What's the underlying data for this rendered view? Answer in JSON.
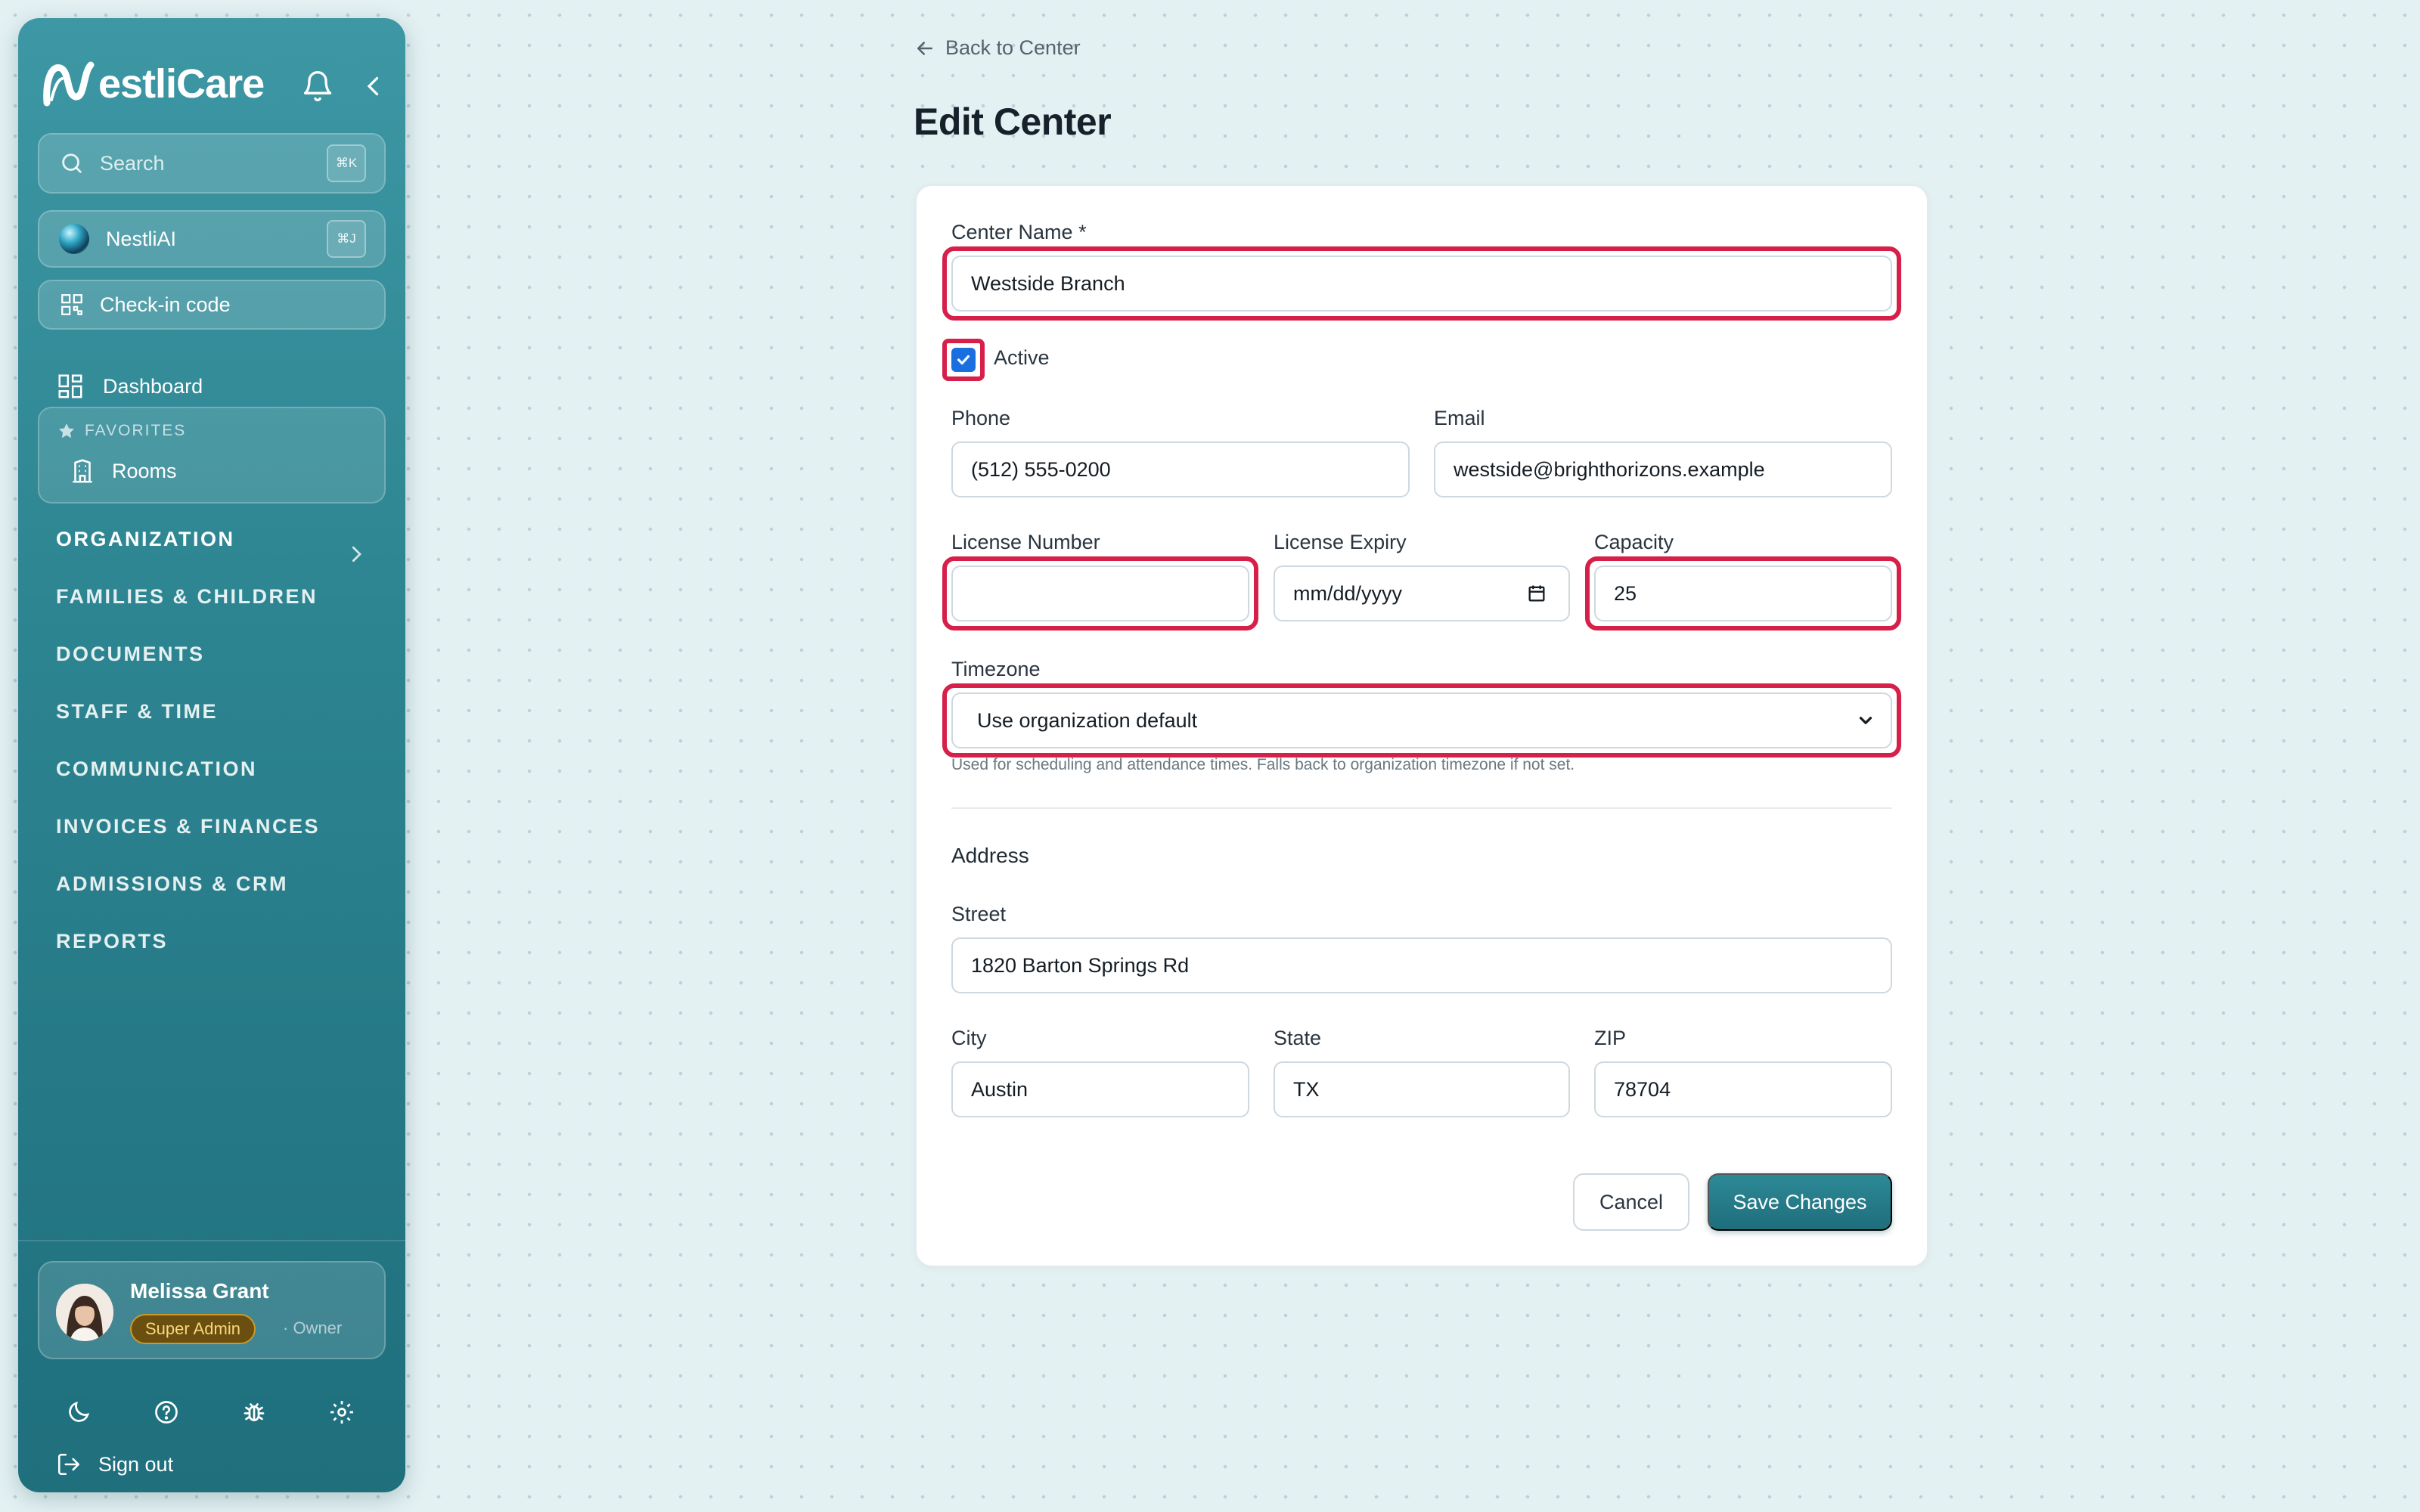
{
  "sidebar": {
    "brand": "estliCare",
    "search": {
      "placeholder": "Search",
      "shortcut": "⌘K"
    },
    "ai": {
      "label": "NestliAI",
      "shortcut": "⌘J"
    },
    "checkin": {
      "label": "Check-in code"
    },
    "dashboard": "Dashboard",
    "favorites": {
      "heading": "FAVORITES",
      "items": [
        "Rooms"
      ]
    },
    "sections": [
      "ORGANIZATION",
      "FAMILIES & CHILDREN",
      "DOCUMENTS",
      "STAFF & TIME",
      "COMMUNICATION",
      "INVOICES & FINANCES",
      "ADMISSIONS & CRM",
      "REPORTS"
    ],
    "user": {
      "name": "Melissa Grant",
      "badge": "Super Admin",
      "role": "· Owner"
    },
    "signout": "Sign out"
  },
  "main": {
    "back_link": "Back to Center",
    "title": "Edit Center",
    "form": {
      "center_name": {
        "label": "Center Name *",
        "value": "Westside Branch"
      },
      "active": {
        "label": "Active",
        "checked": true
      },
      "phone": {
        "label": "Phone",
        "value": "(512) 555-0200"
      },
      "email": {
        "label": "Email",
        "value": "westside@brighthorizons.example"
      },
      "license_number": {
        "label": "License Number",
        "value": ""
      },
      "license_expiry": {
        "label": "License Expiry",
        "value": "mm/dd/yyyy"
      },
      "capacity": {
        "label": "Capacity",
        "value": "25"
      },
      "timezone": {
        "label": "Timezone",
        "value": "Use organization default",
        "hint": "Used for scheduling and attendance times. Falls back to organization timezone if not set."
      },
      "address_title": "Address",
      "street": {
        "label": "Street",
        "value": "1820 Barton Springs Rd"
      },
      "city": {
        "label": "City",
        "value": "Austin"
      },
      "state": {
        "label": "State",
        "value": "TX"
      },
      "zip": {
        "label": "ZIP",
        "value": "78704"
      }
    },
    "buttons": {
      "cancel": "Cancel",
      "save": "Save Changes"
    }
  },
  "colors": {
    "highlight": "#d6204a",
    "accent": "#1f6e7c",
    "checkbox": "#1a6fe0",
    "badge": "#6b4f10"
  }
}
